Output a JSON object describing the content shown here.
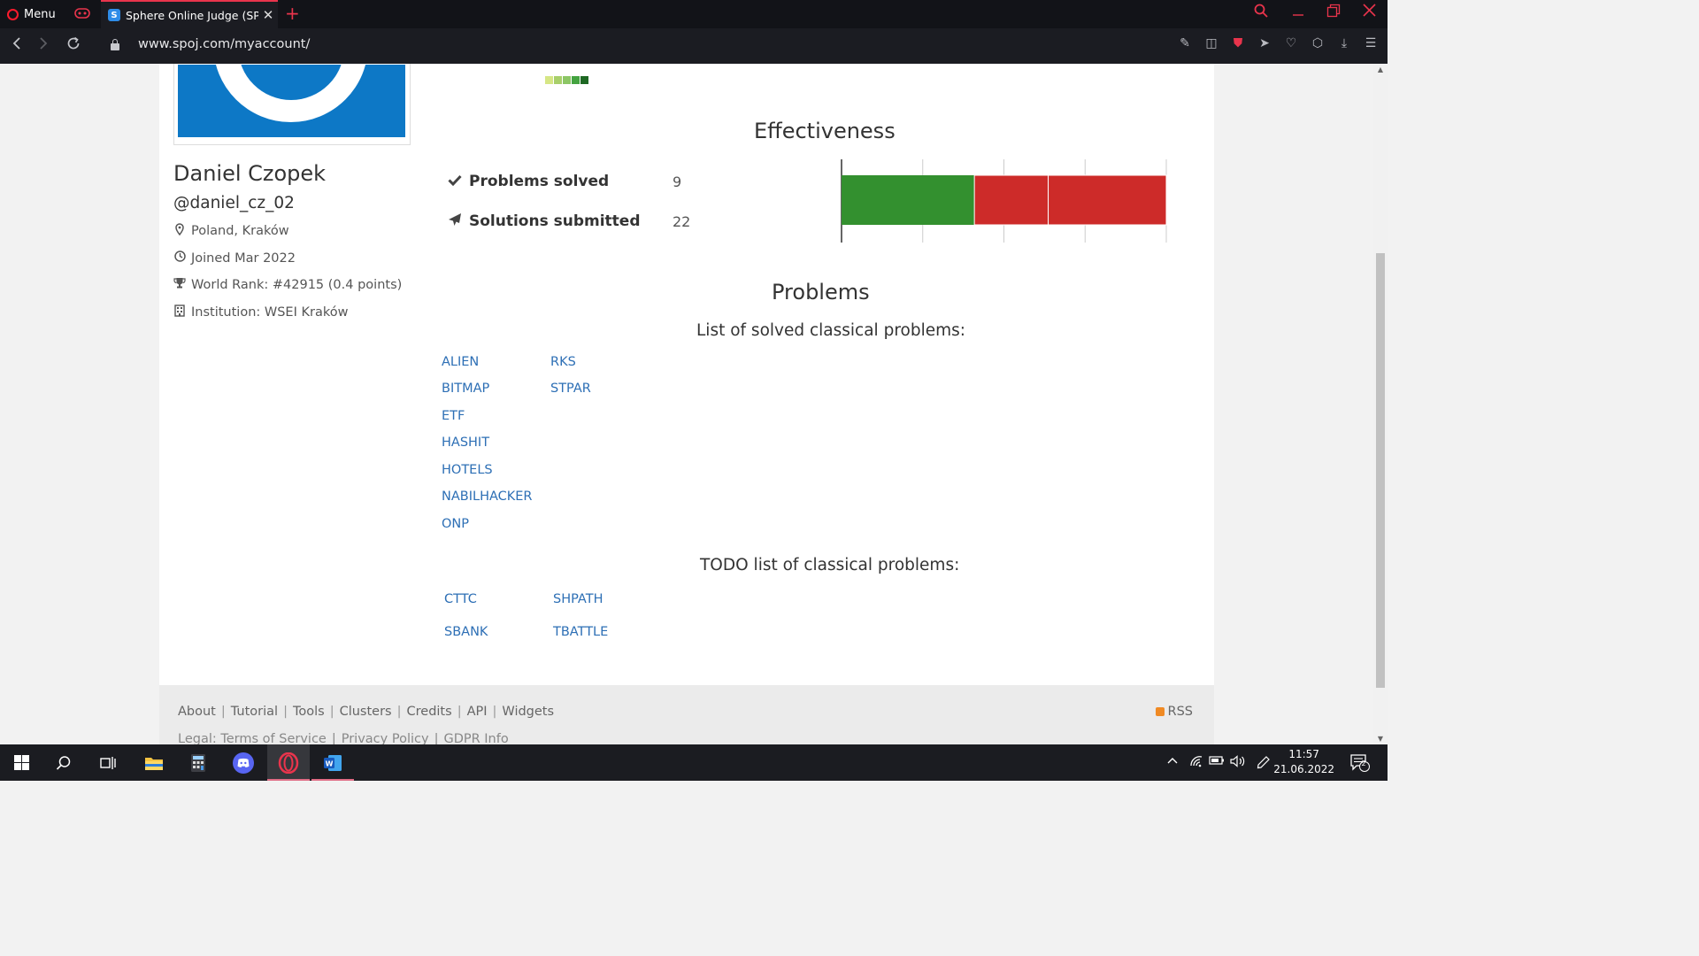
{
  "browser": {
    "menu_label": "Menu",
    "tab_title": "Sphere Online Judge (SPOJ)",
    "tab_favicon": "S",
    "url": "www.spoj.com/myaccount/"
  },
  "profile": {
    "name": "Daniel Czopek",
    "handle": "@daniel_cz_02",
    "location": "Poland, Kraków",
    "joined": "Joined Mar 2022",
    "world_rank": "World Rank: #42915 (0.4 points)",
    "institution": "Institution: WSEI Kraków"
  },
  "activity_colors": [
    "#d6e685",
    "#a8cf6a",
    "#8cc665",
    "#44a340",
    "#1e6823"
  ],
  "effectiveness": {
    "title": "Effectiveness",
    "problems_solved_label": "Problems solved",
    "problems_solved_value": "9",
    "solutions_submitted_label": "Solutions submitted",
    "solutions_submitted_value": "22"
  },
  "chart_data": {
    "type": "bar",
    "orientation": "horizontal",
    "stacked": true,
    "grid": true,
    "segments": [
      {
        "value": 9,
        "color": "#33902f"
      },
      {
        "value": 5,
        "color": "#cd2b29"
      },
      {
        "value": 8,
        "color": "#cd2b29"
      }
    ],
    "total": 22
  },
  "problems": {
    "title": "Problems",
    "solved_title": "List of solved classical problems:",
    "solved": [
      "ALIEN",
      "RKS",
      "BITMAP",
      "STPAR",
      "ETF",
      "HASHIT",
      "HOTELS",
      "NABILHACKER",
      "ONP"
    ],
    "todo_title": "TODO list of classical problems:",
    "todo": [
      "CTTC",
      "SHPATH",
      "SBANK",
      "TBATTLE"
    ]
  },
  "footer": {
    "links": [
      "About",
      "Tutorial",
      "Tools",
      "Clusters",
      "Credits",
      "API",
      "Widgets"
    ],
    "legal_links": [
      "Legal: Terms of Service",
      "Privacy Policy",
      "GDPR Info"
    ],
    "rss": "RSS"
  },
  "taskbar": {
    "time": "11:57",
    "date": "21.06.2022",
    "notifications": "2"
  }
}
